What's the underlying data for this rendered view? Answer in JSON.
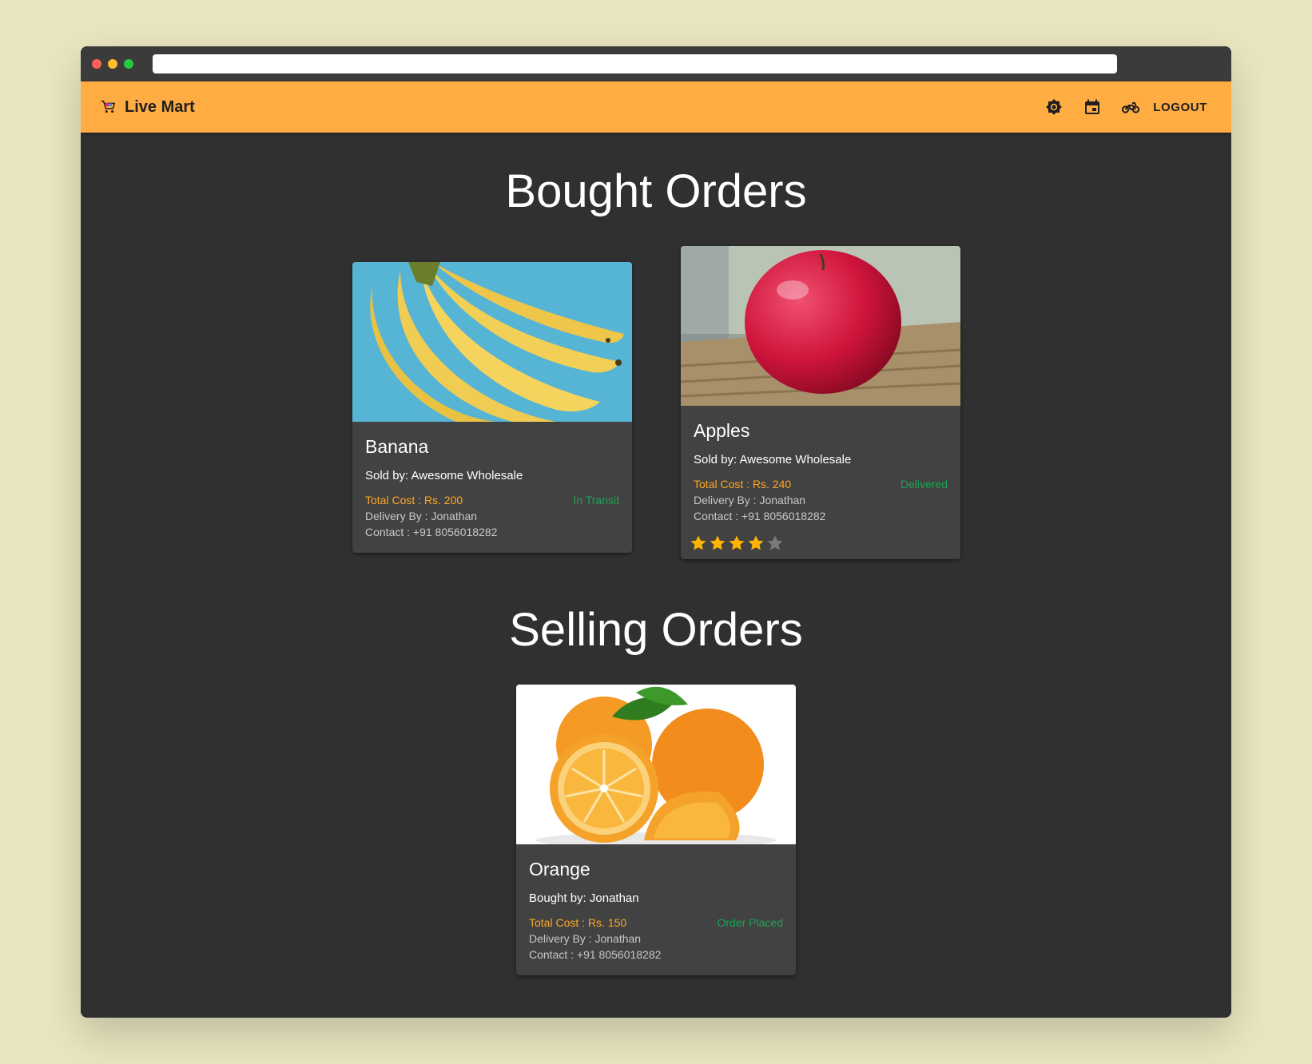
{
  "app": {
    "name": "Live Mart",
    "logo_icon": "shopping-cart-icon",
    "accent": "#ffad42"
  },
  "toolbar": {
    "icons": [
      "brightness-icon",
      "calendar-icon",
      "motorbike-icon"
    ],
    "logout_label": "LOGOUT"
  },
  "bought": {
    "title": "Bought Orders",
    "orders": [
      {
        "name": "Banana",
        "party": "Sold by: Awesome Wholesale",
        "cost": "Total Cost : Rs. 200",
        "status": "In Transit",
        "delivery": "Delivery By : Jonathan",
        "contact": "Contact : +91 8056018282"
      },
      {
        "name": "Apples",
        "party": "Sold by: Awesome Wholesale",
        "cost": "Total Cost : Rs. 240",
        "status": "Delivered",
        "delivery": "Delivery By : Jonathan",
        "contact": "Contact : +91 8056018282",
        "rating": 4,
        "rating_max": 5
      }
    ]
  },
  "selling": {
    "title": "Selling Orders",
    "orders": [
      {
        "name": "Orange",
        "party": "Bought by: Jonathan",
        "cost": "Total Cost : Rs. 150",
        "status": "Order Placed",
        "delivery": "Delivery By : Jonathan",
        "contact": "Contact : +91 8056018282"
      }
    ]
  },
  "colors": {
    "cost": "#ffa726",
    "status": "#1da355",
    "star_filled": "#ffb400",
    "star_empty": "#7a7a7a"
  }
}
